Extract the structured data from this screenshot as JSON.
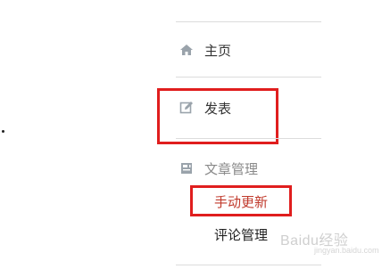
{
  "nav": {
    "home_label": "主页",
    "post_label": "发表",
    "articles_label": "文章管理",
    "manual_update_label": "手动更新",
    "comments_label": "评论管理"
  },
  "watermark": {
    "text": "Baidu经验",
    "sub": "jingyan.baidu.com"
  },
  "colors": {
    "highlight": "#e01e1e",
    "submenu_active": "#c0392b",
    "icon": "#9aa3ab"
  }
}
